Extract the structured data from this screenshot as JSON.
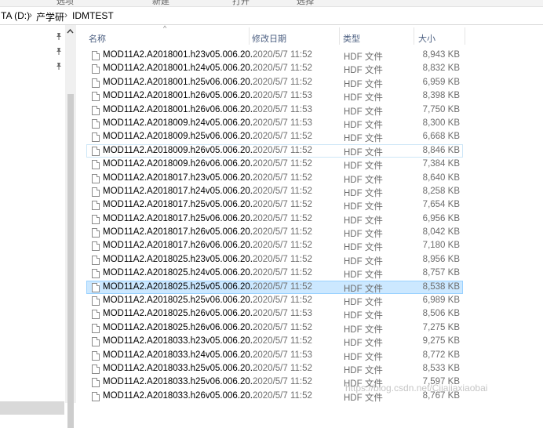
{
  "ribbon": {
    "labels": [
      "选项",
      "新建",
      "打开",
      "选择"
    ]
  },
  "address": {
    "crumbs": [
      "TA (D:)",
      "产学研",
      "IDMTEST"
    ],
    "separator": "›"
  },
  "columns": {
    "name": "名称",
    "date": "修改日期",
    "type": "类型",
    "size": "大小"
  },
  "files": [
    {
      "name": "MOD11A2.A2018001.h23v05.006.20...",
      "date": "2020/5/7 11:52",
      "type": "HDF 文件",
      "size": "8,943 KB"
    },
    {
      "name": "MOD11A2.A2018001.h24v05.006.20...",
      "date": "2020/5/7 11:52",
      "type": "HDF 文件",
      "size": "8,832 KB"
    },
    {
      "name": "MOD11A2.A2018001.h25v06.006.20...",
      "date": "2020/5/7 11:52",
      "type": "HDF 文件",
      "size": "6,959 KB"
    },
    {
      "name": "MOD11A2.A2018001.h26v05.006.20...",
      "date": "2020/5/7 11:53",
      "type": "HDF 文件",
      "size": "8,398 KB"
    },
    {
      "name": "MOD11A2.A2018001.h26v06.006.20...",
      "date": "2020/5/7 11:53",
      "type": "HDF 文件",
      "size": "7,750 KB"
    },
    {
      "name": "MOD11A2.A2018009.h24v05.006.20...",
      "date": "2020/5/7 11:53",
      "type": "HDF 文件",
      "size": "8,300 KB"
    },
    {
      "name": "MOD11A2.A2018009.h25v06.006.20...",
      "date": "2020/5/7 11:52",
      "type": "HDF 文件",
      "size": "6,668 KB"
    },
    {
      "name": "MOD11A2.A2018009.h26v05.006.20...",
      "date": "2020/5/7 11:52",
      "type": "HDF 文件",
      "size": "8,846 KB"
    },
    {
      "name": "MOD11A2.A2018009.h26v06.006.20...",
      "date": "2020/5/7 11:52",
      "type": "HDF 文件",
      "size": "7,384 KB"
    },
    {
      "name": "MOD11A2.A2018017.h23v05.006.20...",
      "date": "2020/5/7 11:52",
      "type": "HDF 文件",
      "size": "8,640 KB"
    },
    {
      "name": "MOD11A2.A2018017.h24v05.006.20...",
      "date": "2020/5/7 11:52",
      "type": "HDF 文件",
      "size": "8,258 KB"
    },
    {
      "name": "MOD11A2.A2018017.h25v05.006.20...",
      "date": "2020/5/7 11:52",
      "type": "HDF 文件",
      "size": "7,654 KB"
    },
    {
      "name": "MOD11A2.A2018017.h25v06.006.20...",
      "date": "2020/5/7 11:52",
      "type": "HDF 文件",
      "size": "6,956 KB"
    },
    {
      "name": "MOD11A2.A2018017.h26v05.006.20...",
      "date": "2020/5/7 11:52",
      "type": "HDF 文件",
      "size": "8,042 KB"
    },
    {
      "name": "MOD11A2.A2018017.h26v06.006.20...",
      "date": "2020/5/7 11:52",
      "type": "HDF 文件",
      "size": "7,180 KB"
    },
    {
      "name": "MOD11A2.A2018025.h23v05.006.20...",
      "date": "2020/5/7 11:52",
      "type": "HDF 文件",
      "size": "8,956 KB"
    },
    {
      "name": "MOD11A2.A2018025.h24v05.006.20...",
      "date": "2020/5/7 11:52",
      "type": "HDF 文件",
      "size": "8,757 KB"
    },
    {
      "name": "MOD11A2.A2018025.h25v05.006.20...",
      "date": "2020/5/7 11:52",
      "type": "HDF 文件",
      "size": "8,538 KB"
    },
    {
      "name": "MOD11A2.A2018025.h25v06.006.20...",
      "date": "2020/5/7 11:52",
      "type": "HDF 文件",
      "size": "6,989 KB"
    },
    {
      "name": "MOD11A2.A2018025.h26v05.006.20...",
      "date": "2020/5/7 11:53",
      "type": "HDF 文件",
      "size": "8,506 KB"
    },
    {
      "name": "MOD11A2.A2018025.h26v06.006.20...",
      "date": "2020/5/7 11:52",
      "type": "HDF 文件",
      "size": "7,275 KB"
    },
    {
      "name": "MOD11A2.A2018033.h23v05.006.20...",
      "date": "2020/5/7 11:52",
      "type": "HDF 文件",
      "size": "9,275 KB"
    },
    {
      "name": "MOD11A2.A2018033.h24v05.006.20...",
      "date": "2020/5/7 11:53",
      "type": "HDF 文件",
      "size": "8,772 KB"
    },
    {
      "name": "MOD11A2.A2018033.h25v05.006.20...",
      "date": "2020/5/7 11:52",
      "type": "HDF 文件",
      "size": "8,533 KB"
    },
    {
      "name": "MOD11A2.A2018033.h25v06.006.20...",
      "date": "2020/5/7 11:52",
      "type": "HDF 文件",
      "size": "7,597 KB"
    },
    {
      "name": "MOD11A2.A2018033.h26v05.006.20...",
      "date": "2020/5/7 11:52",
      "type": "HDF 文件",
      "size": "8,767 KB"
    }
  ],
  "selected_index": 17,
  "outlined_index": 7,
  "watermark": "https://blog.csdn.net/Cjiajiaxiaobai",
  "colors": {
    "selected_bg": "#cce8ff",
    "selected_border": "#99d1ff",
    "header_text": "#4d6082"
  },
  "icons": {
    "pin": "pin-icon",
    "file": "file-icon",
    "scroll_up": "scroll-up-icon"
  }
}
